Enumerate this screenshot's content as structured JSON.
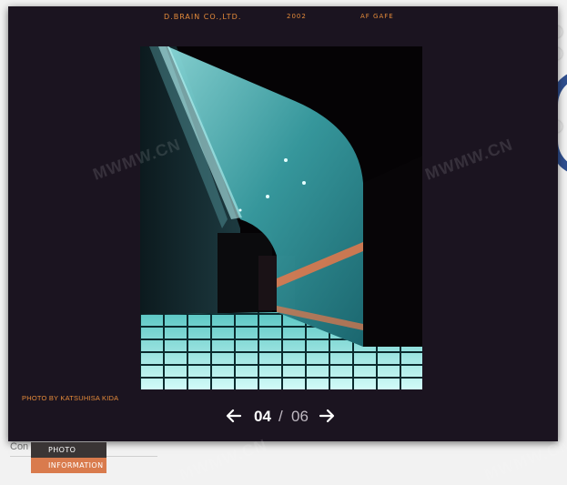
{
  "background": {
    "partial_text": "Con",
    "nav_items": [
      "PHOTO",
      "INFORMATION"
    ]
  },
  "modal": {
    "header": {
      "company": "D.BRAIN CO.,LTD.",
      "year": "2002",
      "project": "AF GAFE"
    },
    "photo_credit": "PHOTO BY KATSUHISA KIDA",
    "pager": {
      "current": "04",
      "separator": "/",
      "total": "06"
    }
  },
  "watermarks": [
    "MWMW.CN",
    "MWMW.CN",
    "MWMW.CN",
    "MWMW.CN"
  ],
  "colors": {
    "modal_bg": "#1b1420",
    "accent_orange": "#e48a3a",
    "nav_active": "#d97b4d",
    "nav_dark": "#3a3535",
    "photo_cyan": "#67c6c8"
  }
}
